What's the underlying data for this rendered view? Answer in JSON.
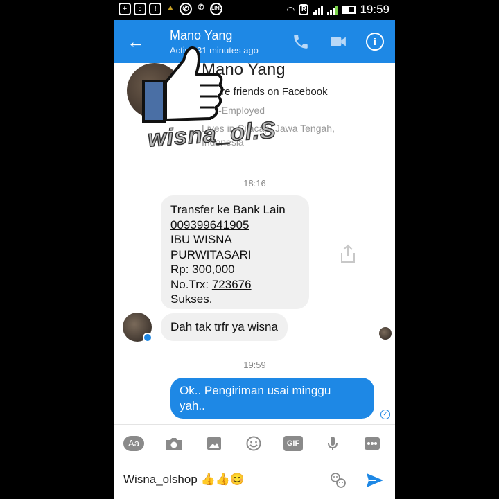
{
  "status_bar": {
    "time": "19:59"
  },
  "header": {
    "name": "Mano Yang",
    "active_status": "Active 31 minutes ago",
    "accent_color": "#1e88e5"
  },
  "profile": {
    "name": "Mano Yang",
    "friends_line": "You're friends on Facebook",
    "job": "Self-Employed",
    "lives": "Lives in Cilacap, Jawa Tengah, Indonesia"
  },
  "watermark": "wisna_ol.S",
  "conversation": {
    "timestamp_1": "18:16",
    "message_1": {
      "line1": "Transfer ke Bank Lain",
      "account": "009399641905",
      "line3": "IBU WISNA",
      "line4": "PURWITASARI",
      "amount": "Rp: 300,000",
      "trx_label": "No.Trx:",
      "trx_number": "723676",
      "status": "Sukses."
    },
    "message_2": "Dah tak trfr ya wisna",
    "timestamp_2": "19:59",
    "message_3": {
      "line1": "Ok..  Pengiriman usai minggu",
      "line2": "yah.."
    }
  },
  "composer": {
    "toolbar": {
      "text_button": "Aa",
      "gif_button": "GIF"
    },
    "input_value": "Wisna_olshop 👍👍😊"
  }
}
